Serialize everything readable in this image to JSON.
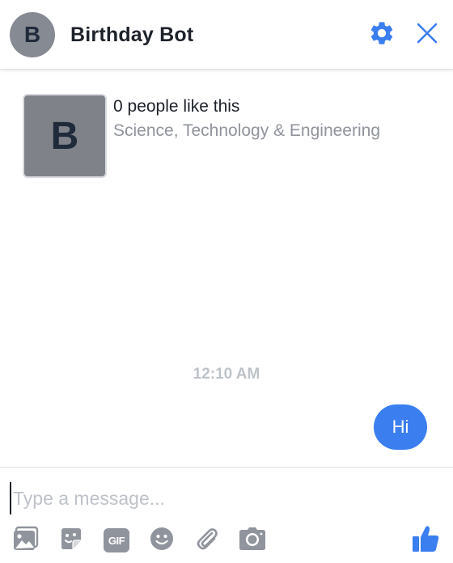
{
  "header": {
    "avatar_letter": "B",
    "title": "Birthday Bot",
    "settings_icon": "gear-icon",
    "close_icon": "close-icon"
  },
  "page_card": {
    "thumb_letter": "B",
    "likes_text": "0 people like this",
    "category": "Science, Technology & Engineering"
  },
  "conversation": {
    "timestamp": "12:10 AM",
    "messages": [
      {
        "from": "me",
        "text": "Hi"
      }
    ]
  },
  "composer": {
    "value": "",
    "placeholder": "Type a message..."
  },
  "toolbar": {
    "icons": [
      "photo-icon",
      "sticker-icon",
      "gif-icon",
      "emoji-icon",
      "attachment-icon",
      "camera-icon",
      "like-icon"
    ],
    "gif_label": "GIF"
  },
  "colors": {
    "accent": "#3a7ef0",
    "icon_gray": "#90949c",
    "avatar_gray": "#868a92",
    "timestamp_gray": "#bec2c9"
  }
}
